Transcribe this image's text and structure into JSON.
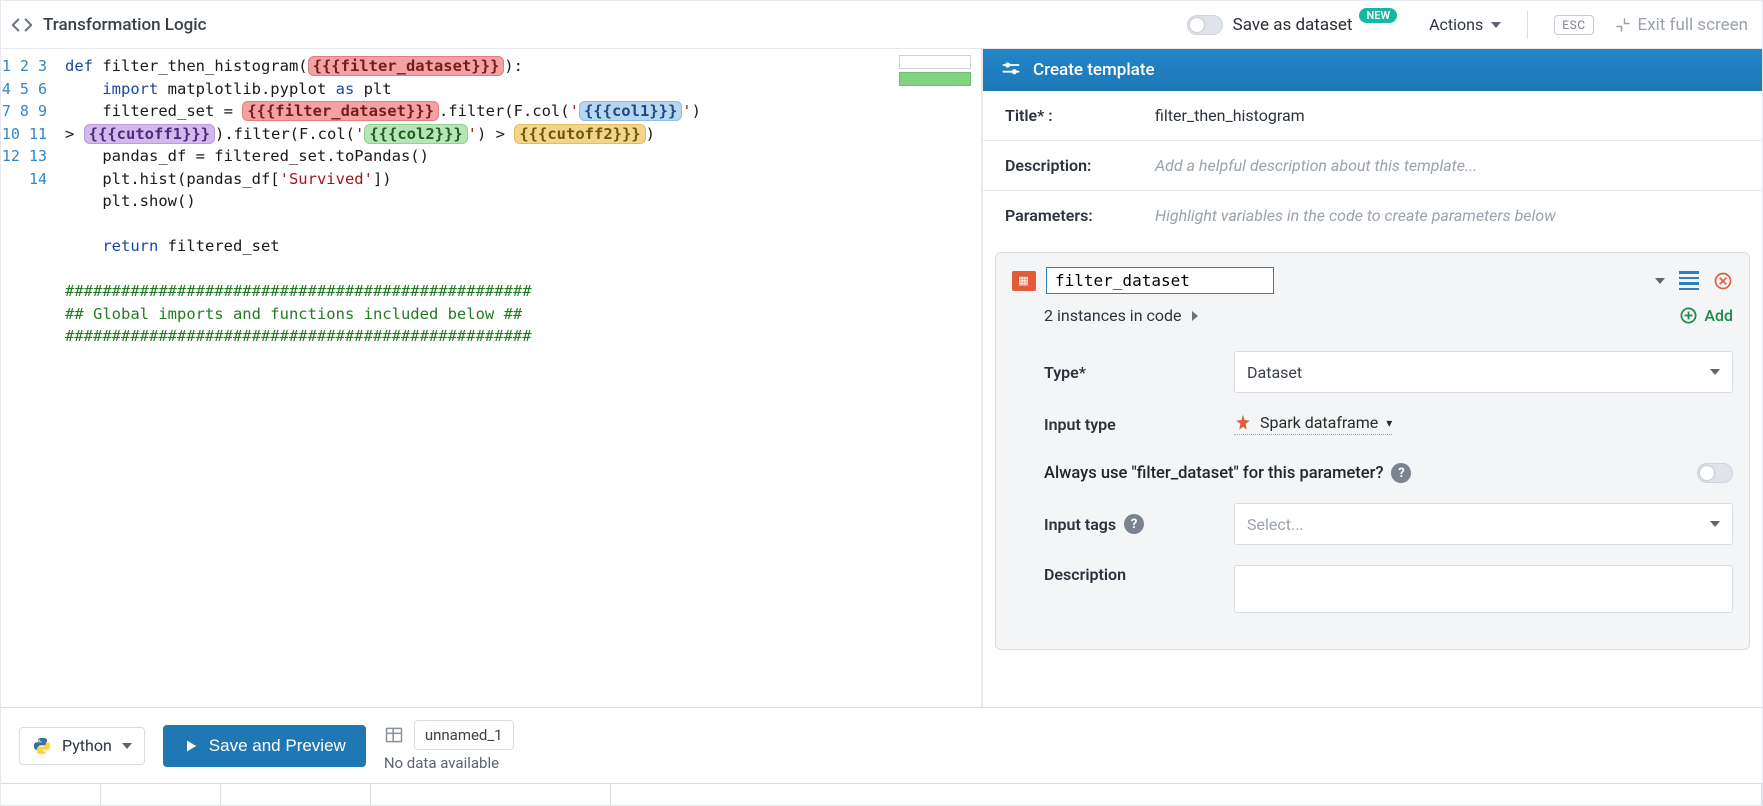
{
  "header": {
    "title": "Transformation Logic",
    "save_as_label": "Save as dataset",
    "new_badge": "NEW",
    "actions_label": "Actions",
    "esc_key": "ESC",
    "exit_fullscreen": "Exit full screen"
  },
  "editor": {
    "line_numbers": [
      "1",
      "2",
      "3",
      "",
      "4",
      "5",
      "6",
      "7",
      "8",
      "9",
      "10",
      "11",
      "12",
      "13",
      "14"
    ],
    "code": {
      "l1_def": "def",
      "l1_fn": " filter_then_histogram(",
      "l1_chip": "{{{filter_dataset}}}",
      "l1_end": "):",
      "l2_import": "import",
      "l2_rest": " matplotlib.pyplot ",
      "l2_as": "as",
      "l2_plt": " plt",
      "l3_a": "    filtered_set = ",
      "l3_chip1": "{{{filter_dataset}}}",
      "l3_b": ".filter(F.col(",
      "l3_q1a": "'",
      "l3_chip2": "{{{col1}}}",
      "l3_q1b": "'",
      "l3_c": ") ",
      "l3w_a": "> ",
      "l3w_chip3": "{{{cutoff1}}}",
      "l3w_b": ").filter(F.col(",
      "l3w_q2a": "'",
      "l3w_chip4": "{{{col2}}}",
      "l3w_q2b": "'",
      "l3w_c": ") > ",
      "l3w_chip5": "{{{cutoff2}}}",
      "l3w_d": ")",
      "l4": "    pandas_df = filtered_set.toPandas()",
      "l5_a": "    plt.hist(pandas_df[",
      "l5_str": "'Survived'",
      "l5_b": "])",
      "l6": "    plt.show()",
      "l7": "",
      "l8_ret": "return",
      "l8_b": " filtered_set",
      "l9": "",
      "l10": "##################################################",
      "l11": "## Global imports and functions included below ##",
      "l12": "##################################################"
    }
  },
  "template": {
    "header": "Create template",
    "title_label": "Title* :",
    "title_value": "filter_then_histogram",
    "desc_label": "Description:",
    "desc_placeholder": "Add a helpful description about this template...",
    "params_label": "Parameters:",
    "params_hint": "Highlight variables in the code to create parameters below",
    "param": {
      "name": "filter_dataset",
      "instances": "2 instances in code",
      "add_label": "Add",
      "type_label": "Type*",
      "type_value": "Dataset",
      "input_type_label": "Input type",
      "input_type_value": "Spark dataframe",
      "always_use": "Always use \"filter_dataset\" for this parameter?",
      "input_tags_label": "Input tags",
      "input_tags_placeholder": "Select...",
      "desc_label": "Description"
    }
  },
  "footer": {
    "lang": "Python",
    "save_preview": "Save and Preview",
    "output_name": "unnamed_1",
    "no_data": "No data available"
  }
}
